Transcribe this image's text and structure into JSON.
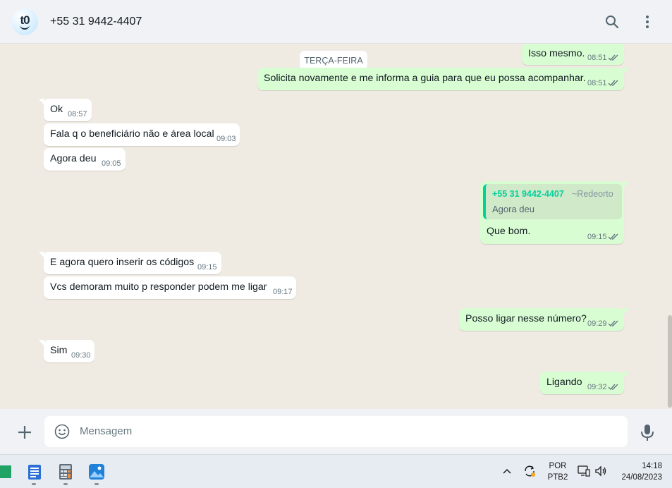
{
  "header": {
    "avatar_text": "t0",
    "contact_name": "+55 31 9442-4407",
    "search_icon": "search-icon",
    "menu_icon": "more-vert-icon"
  },
  "chat": {
    "date_label": "TERÇA-FEIRA",
    "messages": [
      {
        "dir": "out",
        "text": "Isso mesmo.",
        "time": "08:51"
      },
      {
        "dir": "out",
        "text": "Solicita novamente e me informa a guia para que eu possa acompanhar.",
        "time": "08:51"
      },
      {
        "dir": "in",
        "text": "Ok",
        "time": "08:57"
      },
      {
        "dir": "in",
        "text": "Fala q o beneficiário não e área local",
        "time": "09:03"
      },
      {
        "dir": "in",
        "text": "Agora deu",
        "time": "09:05"
      },
      {
        "dir": "out",
        "text": "Que bom.",
        "time": "09:15",
        "quote": {
          "sender": "+55 31 9442-4407",
          "push_name": "~Redeorto",
          "text": "Agora deu"
        }
      },
      {
        "dir": "in",
        "text": "E agora quero inserir os códigos",
        "time": "09:15"
      },
      {
        "dir": "in",
        "text": "Vcs demoram muito p responder podem me ligar",
        "time": "09:17"
      },
      {
        "dir": "out",
        "text": "Posso ligar nesse número?",
        "time": "09:29"
      },
      {
        "dir": "in",
        "text": "Sim",
        "time": "09:30"
      },
      {
        "dir": "out",
        "text": "Ligando",
        "time": "09:32"
      }
    ]
  },
  "composer": {
    "placeholder": "Mensagem",
    "plus_icon": "plus-icon",
    "emoji_icon": "emoji-icon",
    "mic_icon": "mic-icon"
  },
  "taskbar": {
    "apps": [
      "excel-icon",
      "notepad-icon",
      "calculator-icon",
      "photos-icon"
    ],
    "lang_line1": "POR",
    "lang_line2": "PTB2",
    "time": "14:18",
    "date": "24/08/2023"
  },
  "colors": {
    "outgoing_bubble": "#d9fdd3",
    "incoming_bubble": "#ffffff",
    "chat_bg": "#efeae2",
    "accent": "#06cf9c",
    "read_ticks": "#53bdeb"
  }
}
